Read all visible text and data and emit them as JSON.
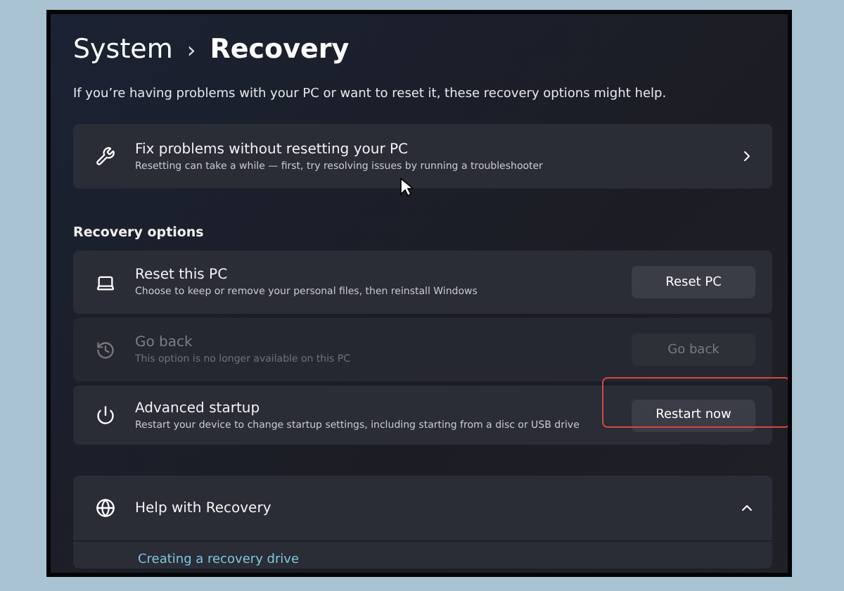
{
  "breadcrumb": {
    "parent": "System",
    "separator": "›",
    "current": "Recovery"
  },
  "description": "If you’re having problems with your PC or want to reset it, these recovery options might help.",
  "fix_card": {
    "title": "Fix problems without resetting your PC",
    "subtitle": "Resetting can take a while — first, try resolving issues by running a troubleshooter"
  },
  "section_title": "Recovery options",
  "options": [
    {
      "kind": "reset",
      "title": "Reset this PC",
      "subtitle": "Choose to keep or remove your personal files, then reinstall Windows",
      "button": "Reset PC",
      "disabled": false,
      "highlighted": false
    },
    {
      "kind": "history",
      "title": "Go back",
      "subtitle": "This option is no longer available on this PC",
      "button": "Go back",
      "disabled": true,
      "highlighted": false
    },
    {
      "kind": "startup",
      "title": "Advanced startup",
      "subtitle": "Restart your device to change startup settings, including starting from a disc or USB drive",
      "button": "Restart now",
      "disabled": false,
      "highlighted": true
    }
  ],
  "help": {
    "title": "Help with Recovery",
    "expanded": true,
    "links": [
      "Creating a recovery drive"
    ]
  }
}
